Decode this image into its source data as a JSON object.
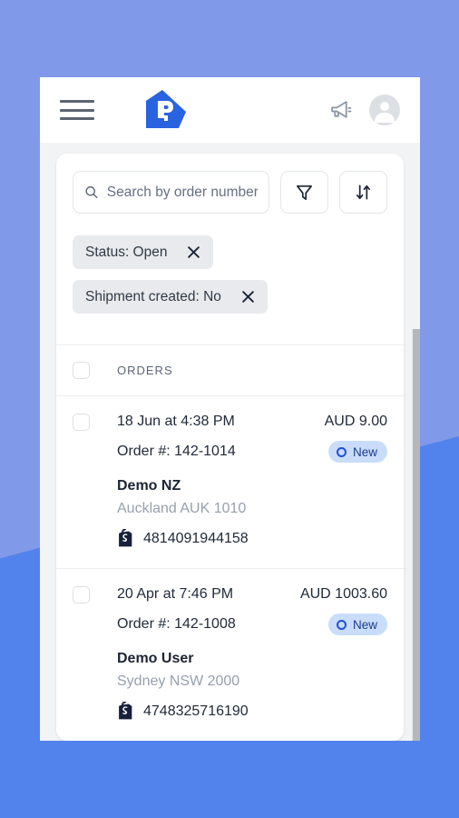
{
  "window": {
    "page_background": "#f1f3f5",
    "wallpaper_top_color": "#8099e8",
    "wallpaper_bottom_color": "#5282ec"
  },
  "topbar": {
    "menu_icon": "hamburger-menu-icon",
    "logo_icon": "brand-house-r-logo",
    "announcements_icon": "megaphone-icon",
    "account_icon": "user-avatar-icon",
    "accent_color": "#2a63e0"
  },
  "search": {
    "placeholder": "Search by order number",
    "value": "",
    "search_icon": "search-icon",
    "filter_icon": "filter-funnel-icon",
    "sort_icon": "sort-arrows-icon"
  },
  "filters": [
    {
      "label": "Status: Open",
      "close_icon": "close-icon"
    },
    {
      "label": "Shipment created: No",
      "close_icon": "close-icon"
    }
  ],
  "orders_header": {
    "title": "ORDERS",
    "select_all_checked": false
  },
  "orders": [
    {
      "checked": false,
      "date": "18 Jun at 4:38 PM",
      "amount": "AUD 9.00",
      "order_number": "Order #: 142-1014",
      "badge": "New",
      "badge_bg": "#c9ddfb",
      "badge_fg": "#1b3b8f",
      "customer": "Demo NZ",
      "location": "Auckland AUK 1010",
      "channel_icon": "shopify-icon",
      "channel_id": "4814091944158"
    },
    {
      "checked": false,
      "date": "20 Apr at 7:46 PM",
      "amount": "AUD 1003.60",
      "order_number": "Order #: 142-1008",
      "badge": "New",
      "badge_bg": "#c9ddfb",
      "badge_fg": "#1b3b8f",
      "customer": "Demo User",
      "location": "Sydney NSW 2000",
      "channel_icon": "shopify-icon",
      "channel_id": "4748325716190"
    }
  ],
  "scrollbar": {
    "orientation": "vertical",
    "thumb_color": "#b4b7bb"
  }
}
